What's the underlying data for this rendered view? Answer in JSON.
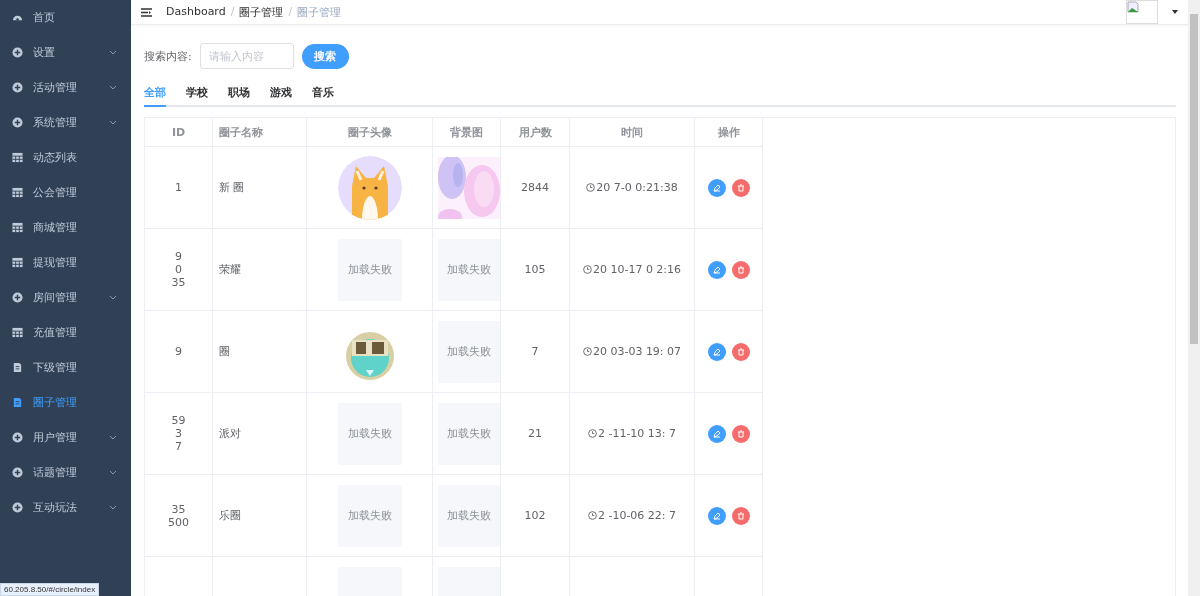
{
  "sidebar": {
    "items": [
      {
        "label": "首页",
        "kind": "gauge",
        "expandable": false,
        "selected": false
      },
      {
        "label": "设置",
        "kind": "circle",
        "expandable": true,
        "selected": false
      },
      {
        "label": "活动管理",
        "kind": "circle",
        "expandable": true,
        "selected": false
      },
      {
        "label": "系统管理",
        "kind": "circle",
        "expandable": true,
        "selected": false
      },
      {
        "label": "动态列表",
        "kind": "table",
        "expandable": false,
        "selected": false
      },
      {
        "label": "公会管理",
        "kind": "table",
        "expandable": false,
        "selected": false
      },
      {
        "label": "商城管理",
        "kind": "table",
        "expandable": false,
        "selected": false
      },
      {
        "label": "提现管理",
        "kind": "table",
        "expandable": false,
        "selected": false
      },
      {
        "label": "房间管理",
        "kind": "circle",
        "expandable": true,
        "selected": false
      },
      {
        "label": "充值管理",
        "kind": "table",
        "expandable": false,
        "selected": false
      },
      {
        "label": "下级管理",
        "kind": "doc",
        "expandable": false,
        "selected": false
      },
      {
        "label": "圈子管理",
        "kind": "doc",
        "expandable": false,
        "selected": true
      },
      {
        "label": "用户管理",
        "kind": "circle",
        "expandable": true,
        "selected": false
      },
      {
        "label": "话题管理",
        "kind": "circle",
        "expandable": true,
        "selected": false
      },
      {
        "label": "互动玩法",
        "kind": "circle",
        "expandable": true,
        "selected": false
      }
    ]
  },
  "breadcrumb": [
    {
      "label": "Dashboard"
    },
    {
      "separator": "/",
      "label": "圈子管理"
    },
    {
      "separator": "/",
      "label": "圈子管理"
    }
  ],
  "search": {
    "label": "搜索内容:",
    "placeholder": "请输入内容",
    "button": "搜索"
  },
  "tabs": [
    {
      "label": "全部",
      "selected": true
    },
    {
      "label": "学校",
      "selected": false
    },
    {
      "label": "职场",
      "selected": false
    },
    {
      "label": "游戏",
      "selected": false
    },
    {
      "label": "音乐",
      "selected": false
    }
  ],
  "table": {
    "columns": [
      "ID",
      "圈子名称",
      "圈子头像",
      "背景图",
      "用户数",
      "时间",
      "操作"
    ],
    "rows": [
      {
        "id": "1",
        "name": "新 圈",
        "avatar": {
          "kind": "corgi"
        },
        "users": "2844",
        "time": "20 7-0 0:21:38"
      },
      {
        "id": "9 0 35",
        "name": "荣耀",
        "avatar": {
          "kind": "failed",
          "text": "加载失败"
        },
        "background": {
          "kind": "failed",
          "text": "加载失败"
        },
        "users": "105",
        "time": "20 10-17 0 2:16"
      },
      {
        "id": "9",
        "name": "圈",
        "avatar": {
          "kind": "emblem"
        },
        "background": {
          "kind": "failed",
          "text": "加载失败"
        },
        "users": "7",
        "time": "20 03-03 19: 07"
      },
      {
        "id": "59 3 7",
        "name": "派对",
        "avatar": {
          "kind": "failed",
          "text": "加载失败"
        },
        "background": {
          "kind": "failed",
          "text": "加载失败"
        },
        "users": "21",
        "time": "2 -11-10 13: 7"
      },
      {
        "id": "35 500",
        "name": "乐圈",
        "avatar": {
          "kind": "failed",
          "text": "加载失败"
        },
        "background": {
          "kind": "failed",
          "text": "加载失败"
        },
        "users": "102",
        "time": "2 -10-06 22: 7"
      },
      {
        "avatar": {
          "kind": "blank"
        },
        "background": {
          "kind": "blank"
        }
      }
    ]
  },
  "status_bar": "60.205.8.50/#/circle/index"
}
